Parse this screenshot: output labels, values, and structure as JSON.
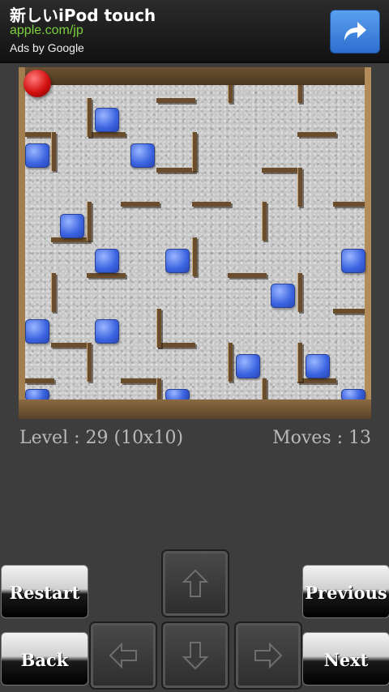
{
  "ad": {
    "title": "新しいiPod touch",
    "url": "apple.com/jp",
    "by": "Ads by Google",
    "action_icon": "share-arrow-icon"
  },
  "game": {
    "level_text": "Level : 29 (10x10)",
    "moves_text": "Moves : 13"
  },
  "buttons": {
    "restart": "Restart",
    "previous": "Previous",
    "back": "Back",
    "next": "Next"
  },
  "dpad": {
    "up_icon": "arrow-up-icon",
    "down_icon": "arrow-down-icon",
    "left_icon": "arrow-left-icon",
    "right_icon": "arrow-right-icon"
  },
  "colors": {
    "ball": "#d21010",
    "tile": "#3b63e0",
    "frame": "#b8915d"
  }
}
